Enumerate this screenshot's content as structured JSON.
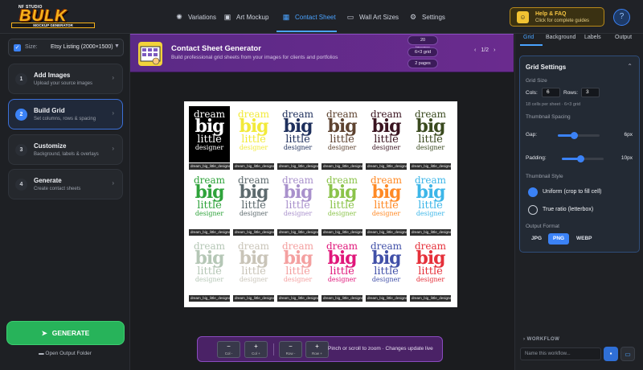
{
  "app": {
    "logo_studio": "NF STUDIO",
    "logo_main": "BULK",
    "logo_sub": "MOCKUP GENERATOR"
  },
  "nav": {
    "tabs": [
      {
        "label": "Variations",
        "icon": "variations-icon",
        "active": false
      },
      {
        "label": "Art Mockup",
        "icon": "image-icon",
        "active": false
      },
      {
        "label": "Contact Sheet",
        "icon": "grid-icon",
        "active": true
      },
      {
        "label": "Wall Art Sizes",
        "icon": "frame-icon",
        "active": false
      },
      {
        "label": "Settings",
        "icon": "gear-icon",
        "active": false
      }
    ],
    "help_title": "Help & FAQ",
    "help_subtitle": "Click for complete guides",
    "help_circle": "?"
  },
  "sidebar": {
    "size_label": "Size:",
    "size_value": "Etsy Listing (2000×1500)",
    "steps": [
      {
        "num": "1",
        "title": "Add Images",
        "desc": "Upload your source images"
      },
      {
        "num": "2",
        "title": "Build Grid",
        "desc": "Set columns, rows & spacing"
      },
      {
        "num": "3",
        "title": "Customize",
        "desc": "Background, labels & overlays"
      },
      {
        "num": "4",
        "title": "Generate",
        "desc": "Create contact sheets"
      }
    ],
    "generate_label": "GENERATE",
    "open_folder_label": "Open Output Folder"
  },
  "banner": {
    "title": "Contact Sheet Generator",
    "subtitle": "Build professional grid sheets from your images for clients and portfolios",
    "pills": [
      "20 images",
      "6×3 grid",
      "2 pages"
    ],
    "page": "1/2"
  },
  "sheet": {
    "words": [
      "dream",
      "big",
      "little",
      "designer"
    ],
    "caption": "dream_big_little_designer",
    "thumbs": [
      {
        "bg": "#000000",
        "fg": "#ffffff"
      },
      {
        "bg": "#ffffff",
        "fg": "#f2ea3a"
      },
      {
        "bg": "#ffffff",
        "fg": "#1e2f5c"
      },
      {
        "bg": "#ffffff",
        "fg": "#5e4330"
      },
      {
        "bg": "#ffffff",
        "fg": "#3a1420"
      },
      {
        "bg": "#ffffff",
        "fg": "#3a4a1f"
      },
      {
        "bg": "#ffffff",
        "fg": "#2fa33b"
      },
      {
        "bg": "#ffffff",
        "fg": "#5d6a6e"
      },
      {
        "bg": "#ffffff",
        "fg": "#a991cc"
      },
      {
        "bg": "#ffffff",
        "fg": "#8bc34a"
      },
      {
        "bg": "#ffffff",
        "fg": "#ff8a26"
      },
      {
        "bg": "#ffffff",
        "fg": "#3db6e8"
      },
      {
        "bg": "#ffffff",
        "fg": "#b5c7b6"
      },
      {
        "bg": "#ffffff",
        "fg": "#c9c4b8"
      },
      {
        "bg": "#ffffff",
        "fg": "#f4a0a0"
      },
      {
        "bg": "#ffffff",
        "fg": "#e0177a"
      },
      {
        "bg": "#ffffff",
        "fg": "#4150a8"
      },
      {
        "bg": "#ffffff",
        "fg": "#e5303a"
      }
    ]
  },
  "toolbar": {
    "buttons": [
      {
        "sym": "−",
        "label": "Col -"
      },
      {
        "sym": "+",
        "label": "Col +"
      },
      {
        "sym": "−",
        "label": "Row -"
      },
      {
        "sym": "+",
        "label": "Row +"
      }
    ],
    "hint": "Pinch or scroll to zoom · Changes update live"
  },
  "right": {
    "tabs": [
      "Grid",
      "Background",
      "Labels",
      "Output"
    ],
    "grid_settings_title": "Grid Settings",
    "grid_size_label": "Grid Size",
    "cols_label": "Cols:",
    "cols_value": "6",
    "rows_label": "Rows:",
    "rows_value": "3",
    "cells_info": "18 cells per sheet · 6×3 grid",
    "spacing_label": "Thumbnail Spacing",
    "gap_label": "Gap:",
    "gap_value": "6px",
    "gap_level": 0.38,
    "padding_label": "Padding:",
    "padding_value": "10px",
    "padding_level": 0.45,
    "style_label": "Thumbnail Style",
    "style_uniform": "Uniform (crop to fill cell)",
    "style_true": "True ratio (letterbox)",
    "format_label": "Output Format",
    "formats": [
      "JPG",
      "PNG",
      "WEBP"
    ],
    "format_selected": "PNG",
    "workflow_label": "WORKFLOW",
    "workflow_placeholder": "Name this workflow..."
  },
  "colors": {
    "accent": "#3b82f6",
    "generate": "#27b35a",
    "banner": "#5b2a86"
  }
}
